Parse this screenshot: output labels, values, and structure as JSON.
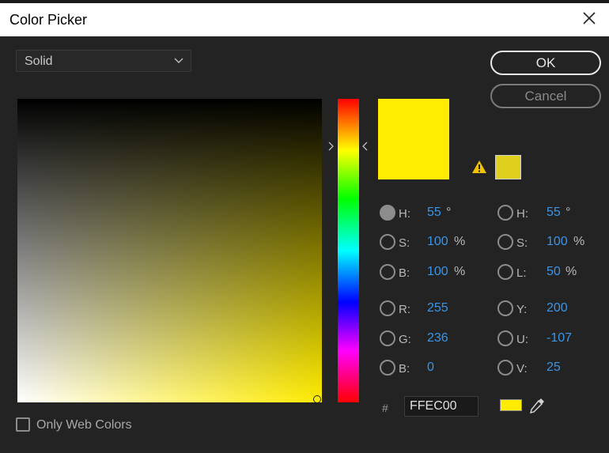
{
  "window": {
    "title": "Color Picker"
  },
  "mode_dropdown": {
    "value": "Solid"
  },
  "buttons": {
    "ok": "OK",
    "cancel": "Cancel"
  },
  "current_color": "#ffec00",
  "websafe_color": "#e0d01e",
  "hsb": {
    "h": {
      "label": "H:",
      "value": "55",
      "unit": "°",
      "selected": true
    },
    "s": {
      "label": "S:",
      "value": "100",
      "unit": "%"
    },
    "b": {
      "label": "B:",
      "value": "100",
      "unit": "%"
    }
  },
  "rgb": {
    "r": {
      "label": "R:",
      "value": "255"
    },
    "g": {
      "label": "G:",
      "value": "236"
    },
    "b": {
      "label": "B:",
      "value": "0"
    }
  },
  "hsl": {
    "h": {
      "label": "H:",
      "value": "55",
      "unit": "°"
    },
    "s": {
      "label": "S:",
      "value": "100",
      "unit": "%"
    },
    "l": {
      "label": "L:",
      "value": "50",
      "unit": "%"
    }
  },
  "yuv": {
    "y": {
      "label": "Y:",
      "value": "200"
    },
    "u": {
      "label": "U:",
      "value": "-107"
    },
    "v": {
      "label": "V:",
      "value": "25"
    }
  },
  "hex": {
    "label": "#",
    "value": "FFEC00"
  },
  "web_colors": {
    "label": "Only Web Colors",
    "checked": false
  },
  "icons": [
    "close-icon",
    "chevron-down-icon",
    "warning-icon",
    "eyedropper-icon"
  ]
}
